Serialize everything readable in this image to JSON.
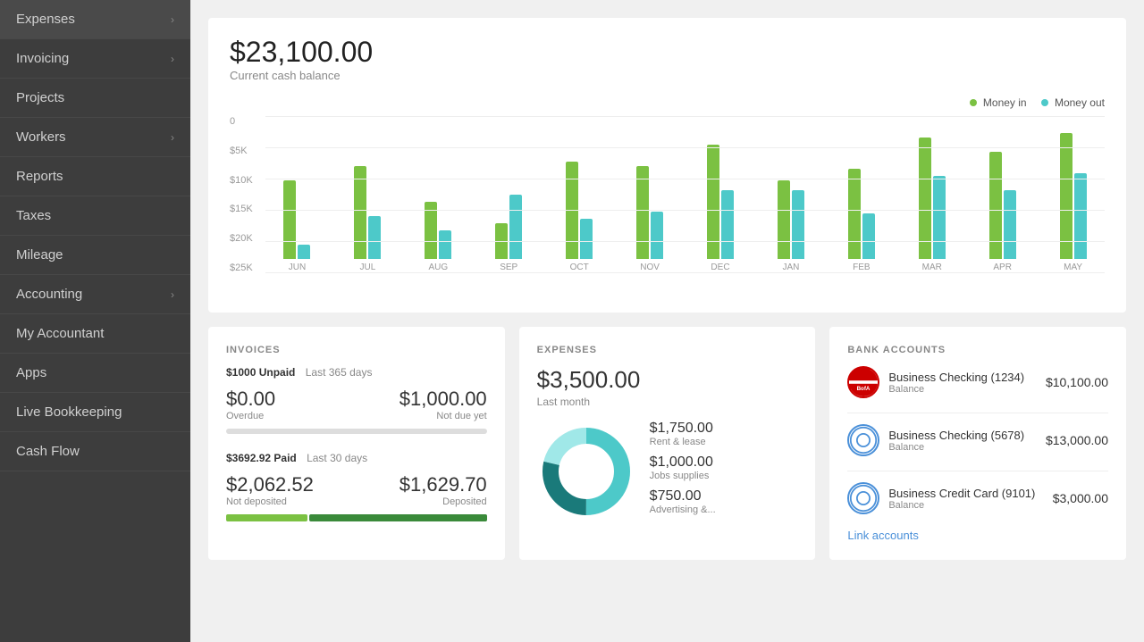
{
  "sidebar": {
    "items": [
      {
        "label": "Expenses",
        "hasChevron": true,
        "name": "expenses"
      },
      {
        "label": "Invoicing",
        "hasChevron": true,
        "name": "invoicing"
      },
      {
        "label": "Projects",
        "hasChevron": false,
        "name": "projects"
      },
      {
        "label": "Workers",
        "hasChevron": true,
        "name": "workers"
      },
      {
        "label": "Reports",
        "hasChevron": false,
        "name": "reports"
      },
      {
        "label": "Taxes",
        "hasChevron": false,
        "name": "taxes"
      },
      {
        "label": "Mileage",
        "hasChevron": false,
        "name": "mileage"
      },
      {
        "label": "Accounting",
        "hasChevron": true,
        "name": "accounting"
      },
      {
        "label": "My Accountant",
        "hasChevron": false,
        "name": "my-accountant"
      },
      {
        "label": "Apps",
        "hasChevron": false,
        "name": "apps"
      },
      {
        "label": "Live Bookkeeping",
        "hasChevron": false,
        "name": "live-bookkeeping"
      },
      {
        "label": "Cash Flow",
        "hasChevron": false,
        "name": "cash-flow"
      }
    ]
  },
  "cashFlow": {
    "amount": "$23,100.00",
    "label": "Current cash balance",
    "legend": {
      "moneyIn": "Money in",
      "moneyOut": "Money out"
    },
    "chart": {
      "yLabels": [
        "$25K",
        "$20K",
        "$15K",
        "$10K",
        "$5K",
        "0"
      ],
      "months": [
        {
          "label": "JUN",
          "green": 55,
          "teal": 10
        },
        {
          "label": "JUL",
          "green": 65,
          "teal": 30
        },
        {
          "label": "AUG",
          "green": 40,
          "teal": 20
        },
        {
          "label": "SEP",
          "green": 25,
          "teal": 45
        },
        {
          "label": "OCT",
          "green": 68,
          "teal": 28
        },
        {
          "label": "NOV",
          "green": 65,
          "teal": 33
        },
        {
          "label": "DEC",
          "green": 80,
          "teal": 48
        },
        {
          "label": "JAN",
          "green": 55,
          "teal": 48
        },
        {
          "label": "FEB",
          "green": 63,
          "teal": 32
        },
        {
          "label": "MAR",
          "green": 85,
          "teal": 58
        },
        {
          "label": "APR",
          "green": 75,
          "teal": 48
        },
        {
          "label": "MAY",
          "green": 88,
          "teal": 60
        }
      ]
    }
  },
  "invoices": {
    "title": "INVOICES",
    "unpaidMeta": "$1000 Unpaid",
    "unpaidPeriod": "Last 365 days",
    "overdue": "$0.00",
    "overdueLabel": "Overdue",
    "notDueYet": "$1,000.00",
    "notDueYetLabel": "Not due yet",
    "paidMeta": "$3692.92 Paid",
    "paidPeriod": "Last 30 days",
    "notDeposited": "$2,062.52",
    "notDepositedLabel": "Not deposited",
    "deposited": "$1,629.70",
    "depositedLabel": "Deposited"
  },
  "expenses": {
    "title": "EXPENSES",
    "amount": "$3,500.00",
    "period": "Last month",
    "breakdown": [
      {
        "amount": "$1,750.00",
        "label": "Rent & lease"
      },
      {
        "amount": "$1,000.00",
        "label": "Jobs supplies"
      },
      {
        "amount": "$750.00",
        "label": "Advertising &..."
      }
    ]
  },
  "bankAccounts": {
    "title": "BANK ACCOUNTS",
    "accounts": [
      {
        "name": "Business Checking (1234)",
        "balanceLabel": "Balance",
        "amount": "$10,100.00",
        "type": "bofa"
      },
      {
        "name": "Business Checking (5678)",
        "balanceLabel": "Balance",
        "amount": "$13,000.00",
        "type": "circle"
      },
      {
        "name": "Business Credit Card (9101)",
        "balanceLabel": "Balance",
        "amount": "$3,000.00",
        "type": "circle"
      }
    ],
    "linkAccounts": "Link accounts"
  }
}
